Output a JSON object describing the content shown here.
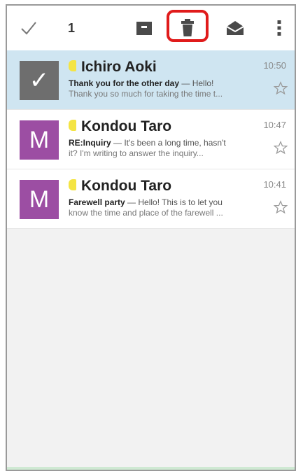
{
  "toolbar": {
    "selected_count": "1",
    "icons": [
      "checkmark-icon",
      "archive-icon",
      "trash-icon",
      "mark-unread-icon",
      "more-vert-icon"
    ]
  },
  "emails": [
    {
      "sender": "Ichiro Aoki",
      "time": "10:50",
      "subject": "Thank you for the other day",
      "snippet": "Hello!",
      "preview": "Thank you so much for taking the time t...",
      "avatar": "✓",
      "selected": true
    },
    {
      "sender": "Kondou Taro",
      "time": "10:47",
      "subject": "RE:Inquiry",
      "snippet": "It's been a long time, hasn't",
      "preview": "it? I'm writing to answer the inquiry...",
      "avatar": "M",
      "selected": false
    },
    {
      "sender": "Kondou Taro",
      "time": "10:41",
      "subject": "Farewell party",
      "snippet": "Hello! This is to let you",
      "preview": "know the time and place of the farewell ...",
      "avatar": "M",
      "selected": false
    }
  ],
  "separator": " — ",
  "colors": {
    "selected_row": "#cfe5f1",
    "avatar_purple": "#9c4ea3",
    "avatar_check": "#6e6e6e",
    "highlight": "#e01b1b",
    "label_tag": "#f4e443"
  }
}
